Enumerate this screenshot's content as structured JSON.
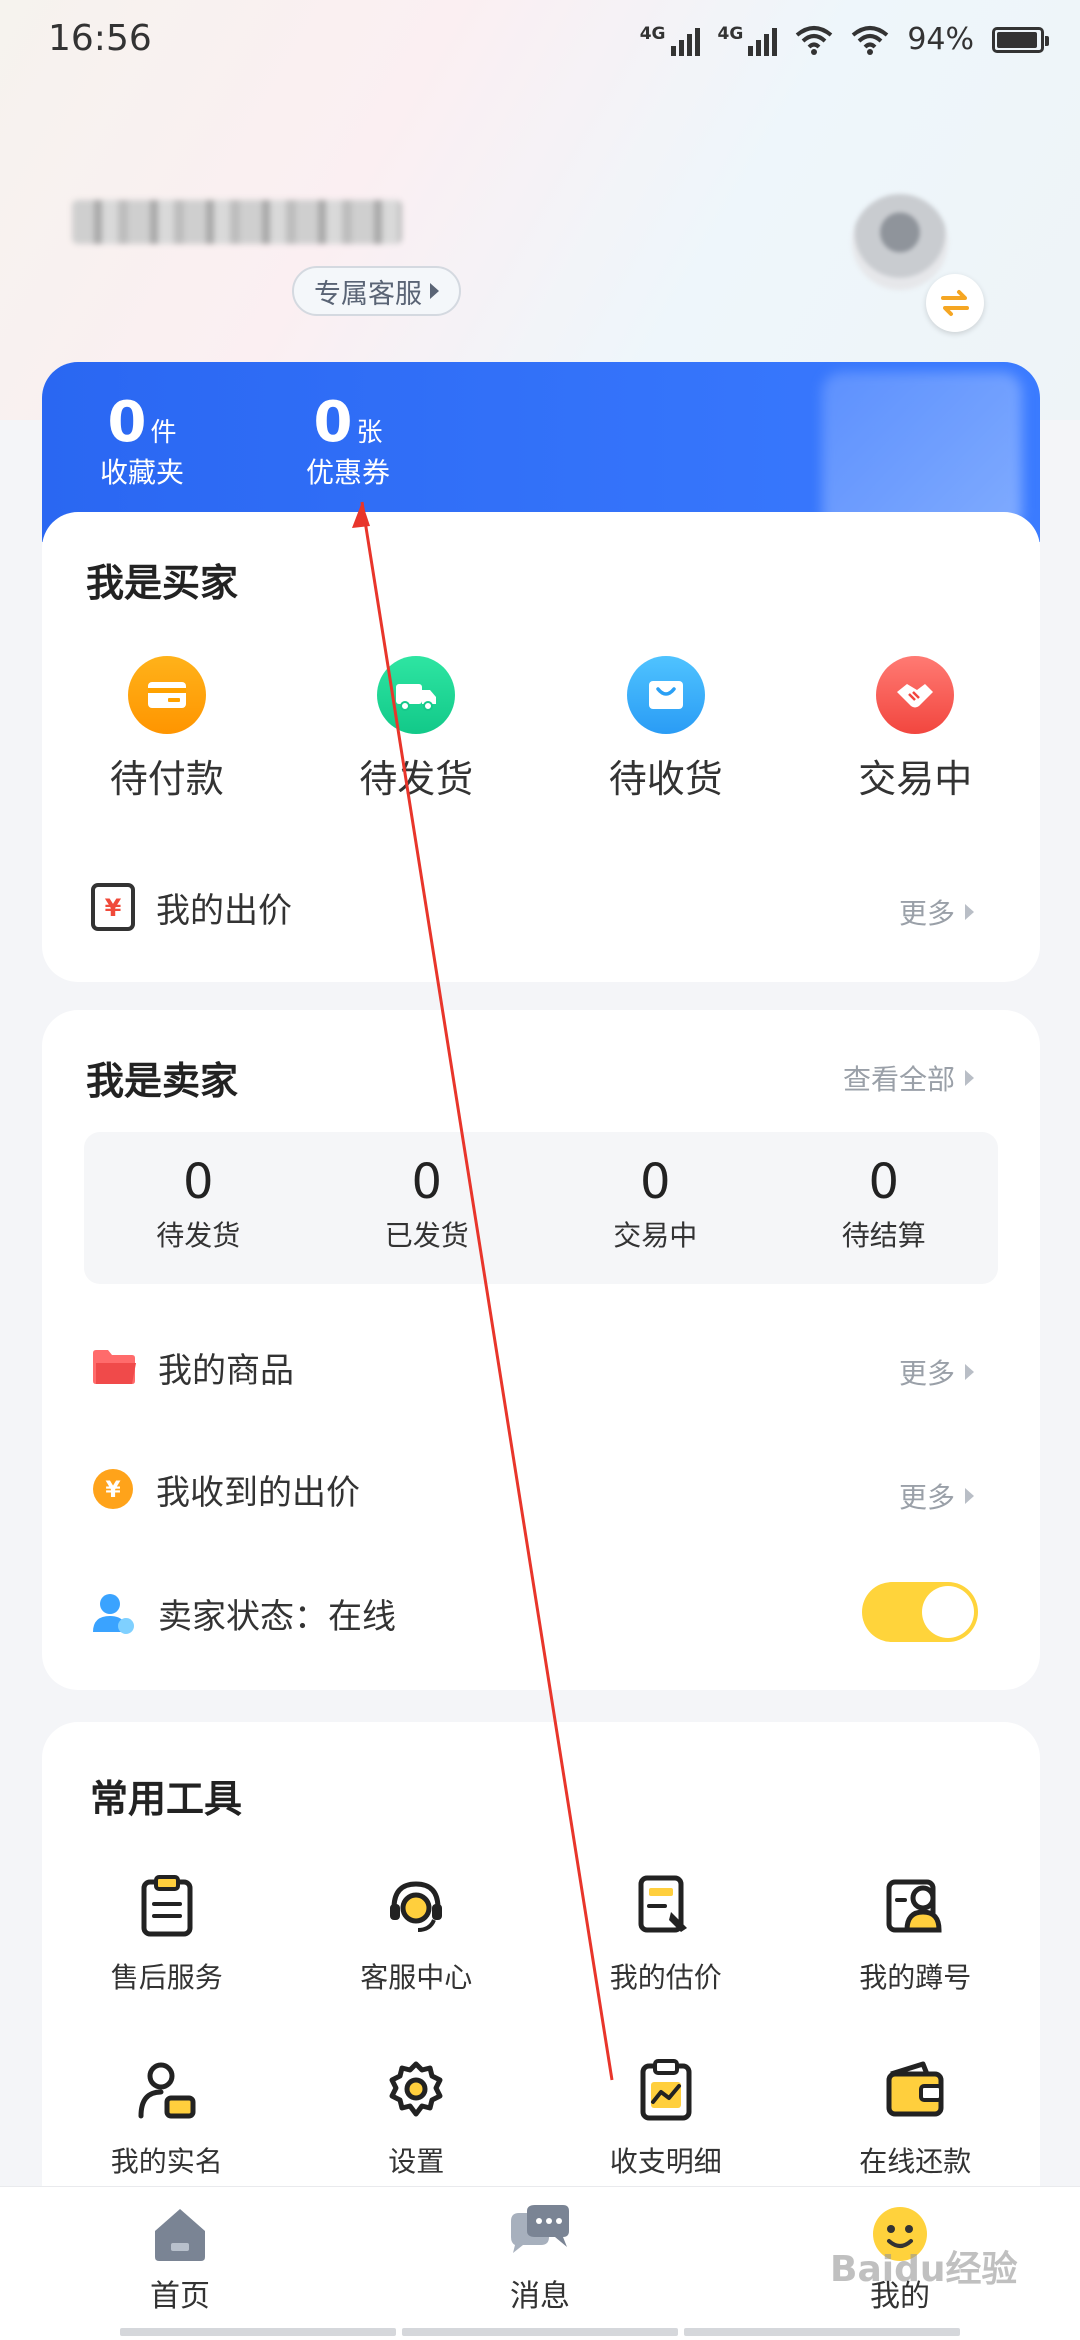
{
  "status_bar": {
    "time": "16:56",
    "net1": "4G",
    "net2": "4G",
    "battery": "94%"
  },
  "profile": {
    "service_button": "专属客服"
  },
  "stats": [
    {
      "value": "0",
      "unit": "件",
      "label": "收藏夹"
    },
    {
      "value": "0",
      "unit": "张",
      "label": "优惠券"
    }
  ],
  "buyer": {
    "title": "我是买家",
    "items": [
      {
        "label": "待付款"
      },
      {
        "label": "待发货"
      },
      {
        "label": "待收货"
      },
      {
        "label": "交易中"
      }
    ],
    "bid_row": {
      "label": "我的出价",
      "more": "更多"
    }
  },
  "seller": {
    "title": "我是卖家",
    "view_all": "查看全部",
    "stats": [
      {
        "value": "0",
        "label": "待发货"
      },
      {
        "value": "0",
        "label": "已发货"
      },
      {
        "value": "0",
        "label": "交易中"
      },
      {
        "value": "0",
        "label": "待结算"
      }
    ],
    "rows": [
      {
        "label": "我的商品",
        "more": "更多"
      },
      {
        "label": "我收到的出价",
        "more": "更多"
      },
      {
        "label": "卖家状态：在线"
      }
    ],
    "online_toggle": true
  },
  "tools": {
    "title": "常用工具",
    "items": [
      {
        "label": "售后服务"
      },
      {
        "label": "客服中心"
      },
      {
        "label": "我的估价"
      },
      {
        "label": "我的蹲号"
      },
      {
        "label": "我的实名"
      },
      {
        "label": "设置"
      },
      {
        "label": "收支明细"
      },
      {
        "label": "在线还款"
      }
    ]
  },
  "nav": [
    {
      "label": "首页"
    },
    {
      "label": "消息"
    },
    {
      "label": "我的"
    }
  ],
  "watermark": "Baidu经验",
  "colors": {
    "primary_blue": "#2a67f2",
    "toggle_yellow": "#ffd43b",
    "annotation_red": "#e8352b"
  }
}
